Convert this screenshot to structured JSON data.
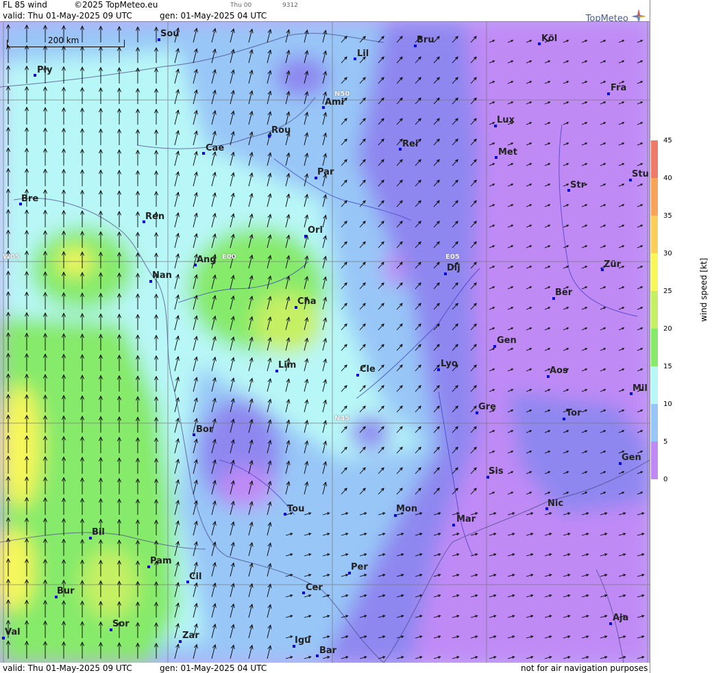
{
  "header": {
    "product": "FL 85 wind",
    "copyright": "©2025 TopMeteo.eu",
    "day_code": "Thu 00",
    "code_id": "9312",
    "valid": "valid:  Thu  01-May-2025  09 UTC",
    "generated": "gen: 01-May-2025 04 UTC",
    "brand": "TopMeteo"
  },
  "footer": {
    "valid": "valid:  Thu  01-May-2025  09 UTC",
    "generated": "gen: 01-May-2025 04 UTC",
    "disclaimer": "not for air navigation purposes"
  },
  "scale_bar": "200 km",
  "grid_labels": [
    "N50",
    "N45",
    "W05",
    "E00",
    "E05"
  ],
  "cities": [
    "Sou",
    "Ply",
    "Lil",
    "Bru",
    "Köl",
    "Ami",
    "Fra",
    "Rou",
    "Lux",
    "Cae",
    "Rei",
    "Met",
    "Par",
    "Stu",
    "Bre",
    "Str",
    "Ren",
    "Orl",
    "Ang",
    "Dij",
    "Zür",
    "Nan",
    "Cha",
    "Ber",
    "Gen",
    "Lim",
    "Cle",
    "Lyo",
    "Aos",
    "Mil",
    "Gre",
    "Tor",
    "Bor",
    "Gen",
    "Sis",
    "Nic",
    "Tou",
    "Mon",
    "Mar",
    "Bil",
    "Pam",
    "Cil",
    "Per",
    "Bur",
    "Cer",
    "Sor",
    "Val",
    "Zar",
    "Igu",
    "Bar",
    "Aja"
  ],
  "legend": {
    "title": "wind speed [kt]",
    "ticks": [
      "45",
      "40",
      "35",
      "30",
      "25",
      "20",
      "15",
      "10",
      "5",
      "0"
    ],
    "colors": [
      "#f07a6a",
      "#f7a35a",
      "#fbd05a",
      "#f7f75a",
      "#c6f063",
      "#86ea6a",
      "#b8f7f7",
      "#98c6f7",
      "#8b8bf0",
      "#c08af5"
    ]
  }
}
